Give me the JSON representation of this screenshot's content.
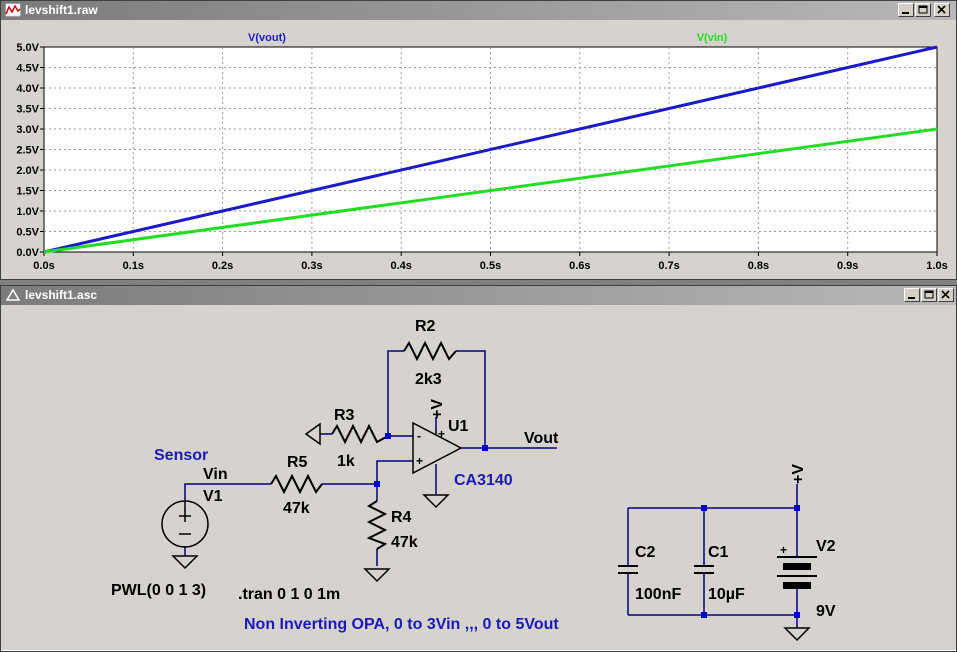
{
  "waveform_window": {
    "title": "levshift1.raw",
    "icon": "waveform-icon",
    "controls": [
      "minimize-icon",
      "restore-icon",
      "close-icon"
    ]
  },
  "schematic_window": {
    "title": "levshift1.asc",
    "icon": "schematic-icon",
    "controls": [
      "minimize-icon",
      "restore-icon",
      "close-icon"
    ]
  },
  "colors": {
    "vout": "#1a1ac8",
    "vin": "#22dd22",
    "wire": "#000080",
    "label": "#1a1ab4",
    "plot_bg": "#ffffff",
    "window_bg": "#d6d3ce"
  },
  "chart_data": {
    "type": "line",
    "title": "",
    "xlabel": "",
    "ylabel": "",
    "xlim": [
      0,
      1.0
    ],
    "ylim": [
      0,
      5.0
    ],
    "grid": true,
    "x_ticks": [
      "0.0s",
      "0.1s",
      "0.2s",
      "0.3s",
      "0.4s",
      "0.5s",
      "0.6s",
      "0.7s",
      "0.8s",
      "0.9s",
      "1.0s"
    ],
    "y_ticks": [
      "0.0V",
      "0.5V",
      "1.0V",
      "1.5V",
      "2.0V",
      "2.5V",
      "3.0V",
      "3.5V",
      "4.0V",
      "4.5V",
      "5.0V"
    ],
    "series": [
      {
        "name": "V(vout)",
        "x": [
          0,
          1.0
        ],
        "values": [
          0,
          5.0
        ],
        "color": "#1a1ac8"
      },
      {
        "name": "V(vin)",
        "x": [
          0,
          1.0
        ],
        "values": [
          0,
          3.0
        ],
        "color": "#22dd22"
      }
    ]
  },
  "schematic": {
    "labels": {
      "r2_name": "R2",
      "r2_value": "2k3",
      "r3_name": "R3",
      "r3_value": "1k",
      "r5_name": "R5",
      "r5_value": "47k",
      "r4_name": "R4",
      "r4_value": "47k",
      "u1_name": "U1",
      "u1_model": "CA3140",
      "u1_supply": "+V",
      "u1_plus": "+",
      "u1_minus": "-",
      "u1_top_plus": "+",
      "vout": "Vout",
      "vin": "Vin",
      "sensor": "Sensor",
      "v1_name": "V1",
      "v1_value": "PWL(0 0 1 3)",
      "tran": ".tran 0 1 0 1m",
      "c2_name": "C2",
      "c2_value": "100nF",
      "c1_name": "C1",
      "c1_value": "10µF",
      "v2_name": "V2",
      "v2_value": "9V",
      "v2_supply": "+V",
      "v2_plus": "+",
      "comment": "Non Inverting OPA, 0 to 3Vin ,,, 0 to 5Vout"
    }
  }
}
